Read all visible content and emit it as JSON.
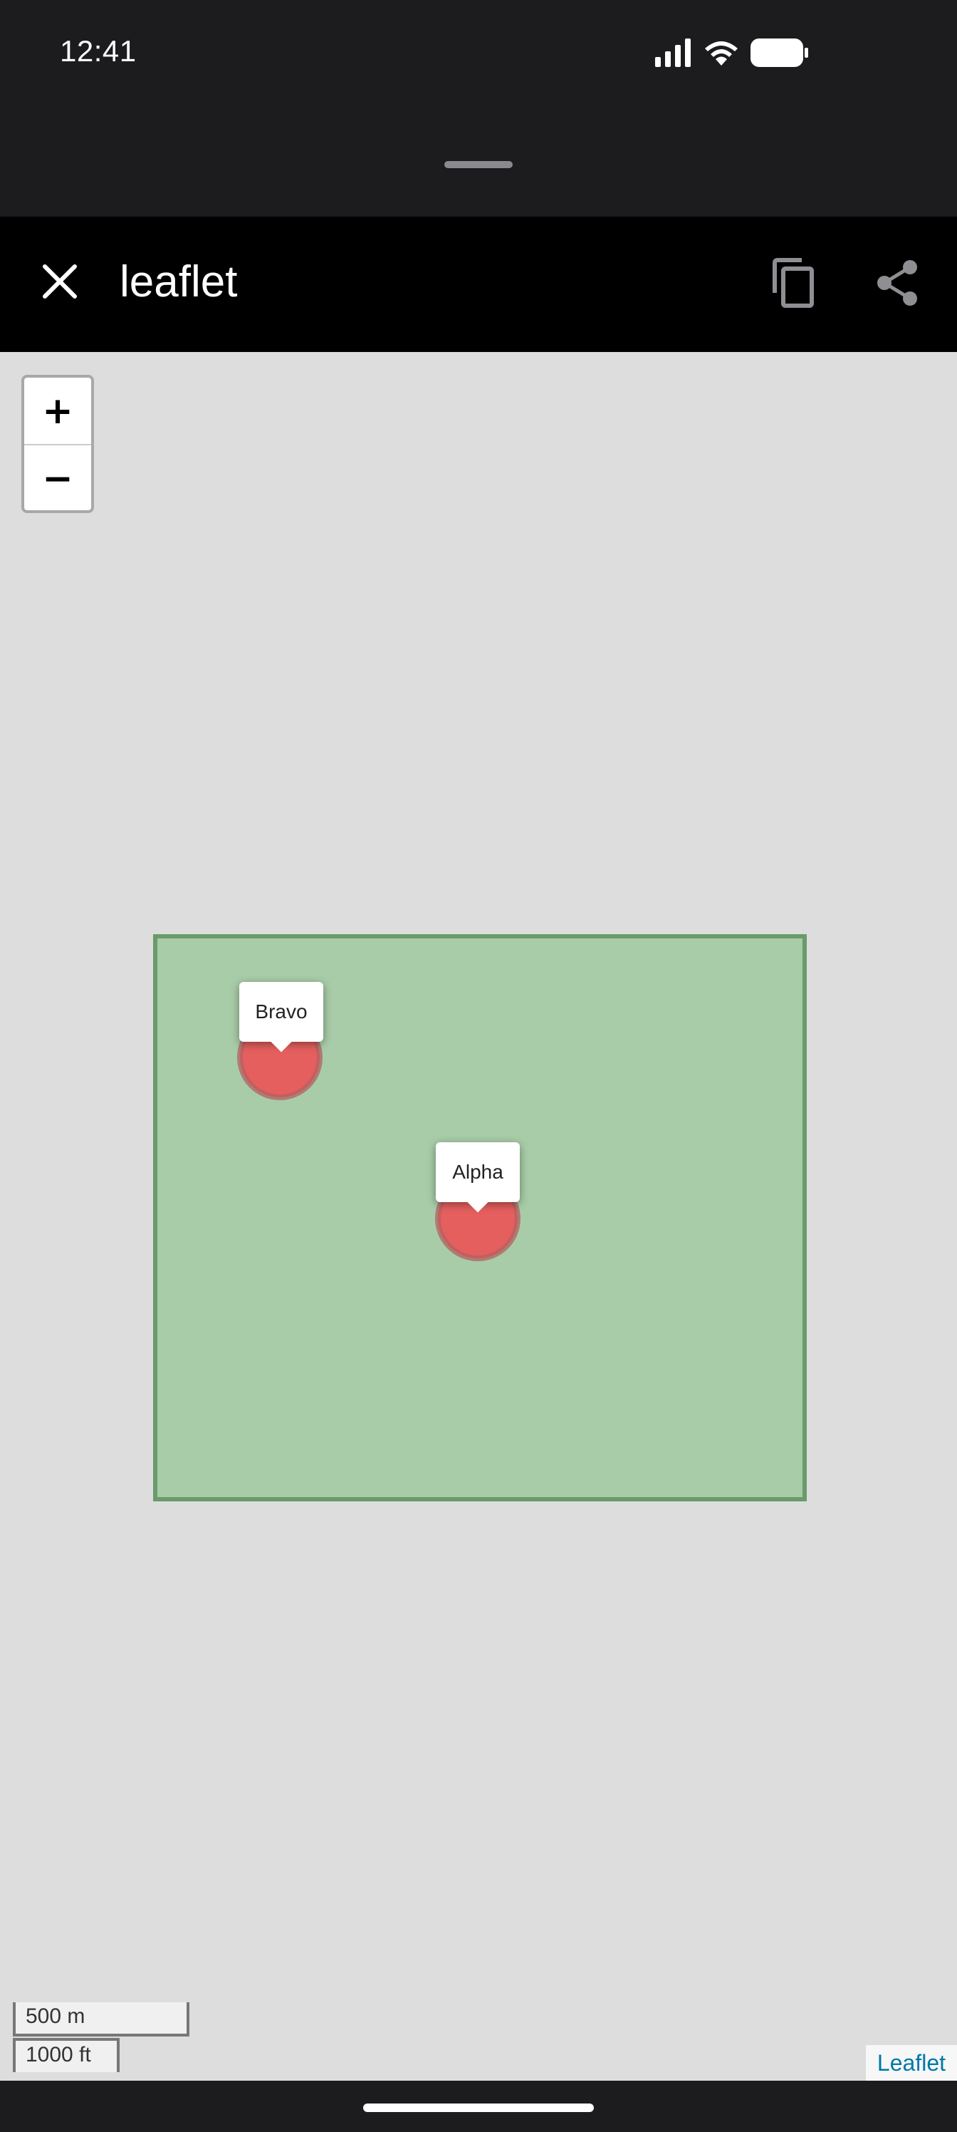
{
  "status_bar": {
    "time": "12:41",
    "icons": [
      "signal-icon",
      "wifi-icon",
      "battery-icon"
    ]
  },
  "app_bar": {
    "title": "leaflet",
    "close_icon": "close-icon",
    "copy_icon": "copy-icon",
    "share_icon": "share-icon"
  },
  "map": {
    "zoom_in_label": "+",
    "zoom_out_label": "−",
    "polygon": {
      "fill_color": "#a8cca8",
      "stroke_color": "#6b9a6b"
    },
    "markers": [
      {
        "name": "Bravo",
        "color": "#e8595a"
      },
      {
        "name": "Alpha",
        "color": "#e8595a"
      }
    ],
    "scale_metric": "500 m",
    "scale_imperial": "1000 ft",
    "attribution": "Leaflet"
  }
}
